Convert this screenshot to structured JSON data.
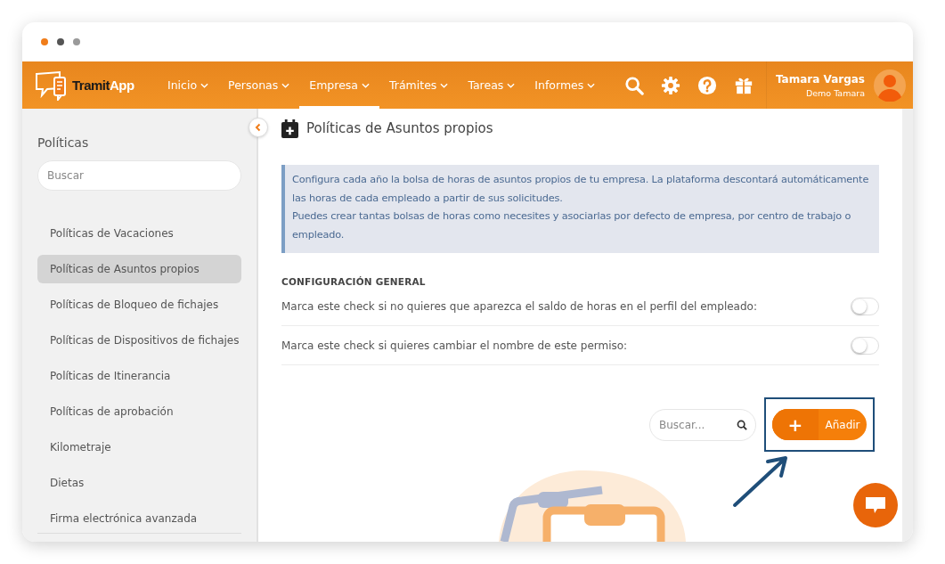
{
  "window": {
    "dots": [
      {
        "color": "#f07d1a"
      },
      {
        "color": "#555555"
      },
      {
        "color": "#9a9a9a"
      }
    ]
  },
  "navbar": {
    "logo": {
      "part1": "Tramit",
      "part2": "App"
    },
    "menu": [
      {
        "label": "Inicio",
        "selected": false
      },
      {
        "label": "Personas",
        "selected": false
      },
      {
        "label": "Empresa",
        "selected": true
      },
      {
        "label": "Trámites",
        "selected": false
      },
      {
        "label": "Tareas",
        "selected": false
      },
      {
        "label": "Informes",
        "selected": false
      }
    ],
    "user": {
      "name": "Tamara Vargas",
      "company": "Demo Tamara"
    }
  },
  "sidebar": {
    "title": "Políticas",
    "search": {
      "placeholder": "Buscar"
    },
    "items": [
      {
        "label": "Políticas de Vacaciones",
        "selected": false
      },
      {
        "label": "Políticas de Asuntos propios",
        "selected": true
      },
      {
        "label": "Políticas de Bloqueo de fichajes",
        "selected": false
      },
      {
        "label": "Políticas de Dispositivos de fichajes",
        "selected": false
      },
      {
        "label": "Políticas de Itinerancia",
        "selected": false
      },
      {
        "label": "Políticas de aprobación",
        "selected": false
      },
      {
        "label": "Kilometraje",
        "selected": false
      },
      {
        "label": "Dietas",
        "selected": false
      },
      {
        "label": "Firma electrónica avanzada",
        "selected": false
      }
    ]
  },
  "main": {
    "title": "Políticas de Asuntos propios",
    "info": [
      "Configura cada año la bolsa de horas de asuntos propios de tu empresa. La plataforma descontará automáticamente las horas de cada empleado a partir de sus solicitudes.",
      "Puedes crear tantas bolsas de horas como necesites y asociarlas por defecto de empresa, por centro de trabajo o empleado."
    ],
    "section_title": "CONFIGURACIÓN GENERAL",
    "settings": [
      {
        "label": "Marca este check si no quieres que aparezca el saldo de horas en el perfil del empleado:",
        "checked": false
      },
      {
        "label": "Marca este check si quieres cambiar el nombre de este permiso:",
        "checked": false
      }
    ],
    "search": {
      "placeholder": "Buscar..."
    },
    "add_button": {
      "icon": "+",
      "label": "Añadir"
    }
  }
}
